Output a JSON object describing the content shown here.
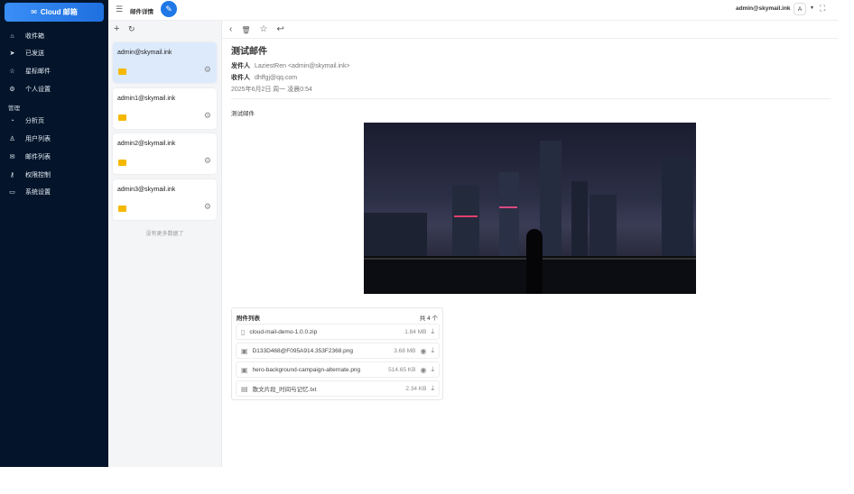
{
  "sidebar": {
    "brand": "Cloud 邮箱",
    "items": [
      {
        "label": "收件箱",
        "icon": "inbox-icon"
      },
      {
        "label": "已发送",
        "icon": "send-icon"
      },
      {
        "label": "星标邮件",
        "icon": "star-icon"
      },
      {
        "label": "个人设置",
        "icon": "settings-icon"
      }
    ],
    "section": "管理",
    "admin_items": [
      {
        "label": "分析页",
        "icon": "chart-pie-icon"
      },
      {
        "label": "用户列表",
        "icon": "user-icon"
      },
      {
        "label": "邮件列表",
        "icon": "mail-list-icon"
      },
      {
        "label": "权限控制",
        "icon": "key-icon"
      },
      {
        "label": "系统设置",
        "icon": "monitor-icon"
      }
    ]
  },
  "header": {
    "title": "邮件详情",
    "user": "admin@skymail.ink",
    "avatar": "A"
  },
  "accounts": {
    "items": [
      "admin@skymail.ink",
      "admin1@skymail.ink",
      "admin2@skymail.ink",
      "admin3@skymail.ink"
    ],
    "no_more": "没有更多数据了"
  },
  "email": {
    "subject": "测试邮件",
    "from_label": "发件人",
    "from": "LaziestRen <admin@skymail.ink>",
    "to_label": "收件人",
    "to": "dhffgj@qq.com",
    "date": "2025年6月2日 周一 凌晨0:54",
    "body": "测试邮件"
  },
  "attachments": {
    "title": "附件列表",
    "count": "共 4 个",
    "items": [
      {
        "name": "cloud-mail-demo-1.0.0.zip",
        "size": "1.84 MB",
        "preview": false,
        "icon": "zip-file-icon"
      },
      {
        "name": "D133D468@F095A914.353F2368.png",
        "size": "3.68 MB",
        "preview": true,
        "icon": "image-file-icon"
      },
      {
        "name": "hero-background-campaign-alternate.png",
        "size": "514.65 KB",
        "preview": true,
        "icon": "image-file-icon"
      },
      {
        "name": "散文片段_时间与记忆.txt",
        "size": "2.34 KB",
        "preview": false,
        "icon": "text-file-icon"
      }
    ]
  }
}
